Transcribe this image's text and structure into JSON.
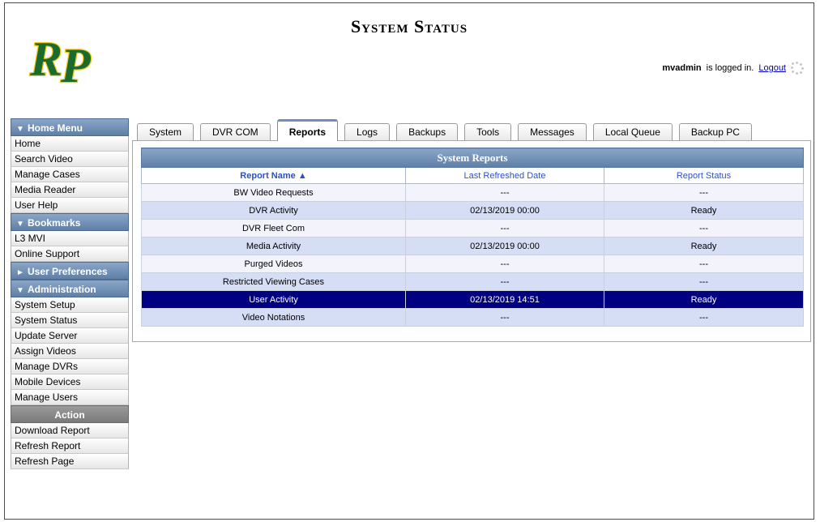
{
  "header": {
    "title": "System Status",
    "logo_text": "RP",
    "username": "mvadmin",
    "logged_in_text": "is logged in.",
    "logout_label": "Logout"
  },
  "sidebar": {
    "home_menu": {
      "label": "Home Menu",
      "items": [
        "Home",
        "Search Video",
        "Manage Cases",
        "Media Reader",
        "User Help"
      ]
    },
    "bookmarks": {
      "label": "Bookmarks",
      "items": [
        "L3 MVI",
        "Online Support"
      ]
    },
    "user_preferences": {
      "label": "User Preferences"
    },
    "administration": {
      "label": "Administration",
      "items": [
        "System Setup",
        "System Status",
        "Update Server",
        "Assign Videos",
        "Manage DVRs",
        "Mobile Devices",
        "Manage Users"
      ]
    },
    "action": {
      "label": "Action",
      "items": [
        "Download Report",
        "Refresh Report",
        "Refresh Page"
      ]
    }
  },
  "tabs": [
    "System",
    "DVR COM",
    "Reports",
    "Logs",
    "Backups",
    "Tools",
    "Messages",
    "Local Queue",
    "Backup PC"
  ],
  "active_tab": "Reports",
  "reports_table": {
    "caption": "System Reports",
    "columns": [
      "Report Name ▲",
      "Last Refreshed Date",
      "Report Status"
    ],
    "rows": [
      [
        "BW Video Requests",
        "---",
        "---"
      ],
      [
        "DVR Activity",
        "02/13/2019 00:00",
        "Ready"
      ],
      [
        "DVR Fleet Com",
        "---",
        "---"
      ],
      [
        "Media Activity",
        "02/13/2019 00:00",
        "Ready"
      ],
      [
        "Purged Videos",
        "---",
        "---"
      ],
      [
        "Restricted Viewing Cases",
        "---",
        "---"
      ],
      [
        "User Activity",
        "02/13/2019 14:51",
        "Ready"
      ],
      [
        "Video Notations",
        "---",
        "---"
      ]
    ],
    "selected_row": 6
  },
  "colors": {
    "header_blue": "#6f8fb7",
    "selected_row": "#000080",
    "logo_green": "#1b6b2e",
    "logo_yellow": "#f2c81e",
    "link_blue": "#2a52c9"
  }
}
